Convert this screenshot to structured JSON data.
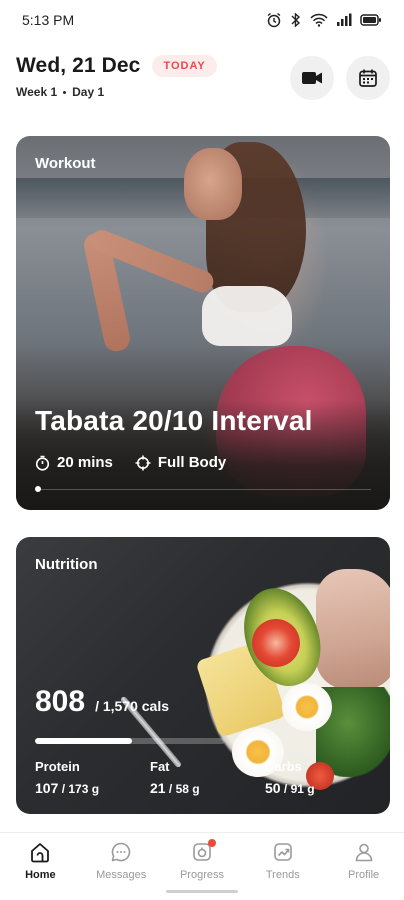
{
  "status_bar": {
    "time": "5:13 PM",
    "battery_level": "full"
  },
  "header": {
    "date": "Wed, 21 Dec",
    "badge": "TODAY",
    "week": "Week 1",
    "day": "Day 1",
    "badge_color": "#e84a4a",
    "actions": [
      {
        "icon": "video-camera-icon"
      },
      {
        "icon": "calendar-icon"
      }
    ]
  },
  "workout": {
    "label": "Workout",
    "title": "Tabata 20/10 Interval",
    "duration": "20 mins",
    "focus": "Full Body",
    "carousel_page": 1
  },
  "nutrition": {
    "label": "Nutrition",
    "calories": "808",
    "calories_goal": "/ 1,570 cals",
    "calories_progress": 0.51,
    "macros": [
      {
        "name": "Protein",
        "value": "107",
        "goal": " / 173 g"
      },
      {
        "name": "Fat",
        "value": "21",
        "goal": " / 58 g"
      },
      {
        "name": "Carbs",
        "value": "50",
        "goal": " / 91 g"
      }
    ]
  },
  "nav": {
    "items": [
      {
        "label": "Home",
        "icon": "home-icon",
        "active": true
      },
      {
        "label": "Messages",
        "icon": "chat-bubble-icon",
        "active": false
      },
      {
        "label": "Progress",
        "icon": "progress-icon",
        "active": false,
        "notification": true
      },
      {
        "label": "Trends",
        "icon": "trends-icon",
        "active": false
      },
      {
        "label": "Profile",
        "icon": "profile-icon",
        "active": false
      }
    ]
  }
}
